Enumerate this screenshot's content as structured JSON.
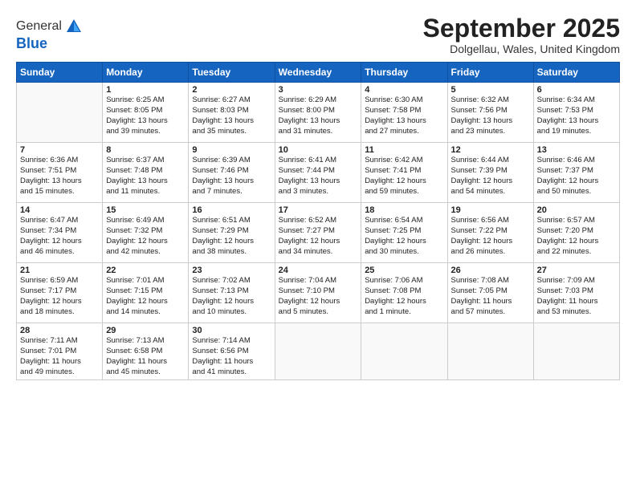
{
  "logo": {
    "general": "General",
    "blue": "Blue"
  },
  "header": {
    "month": "September 2025",
    "location": "Dolgellau, Wales, United Kingdom"
  },
  "weekdays": [
    "Sunday",
    "Monday",
    "Tuesday",
    "Wednesday",
    "Thursday",
    "Friday",
    "Saturday"
  ],
  "weeks": [
    [
      {
        "day": "",
        "info": ""
      },
      {
        "day": "1",
        "info": "Sunrise: 6:25 AM\nSunset: 8:05 PM\nDaylight: 13 hours\nand 39 minutes."
      },
      {
        "day": "2",
        "info": "Sunrise: 6:27 AM\nSunset: 8:03 PM\nDaylight: 13 hours\nand 35 minutes."
      },
      {
        "day": "3",
        "info": "Sunrise: 6:29 AM\nSunset: 8:00 PM\nDaylight: 13 hours\nand 31 minutes."
      },
      {
        "day": "4",
        "info": "Sunrise: 6:30 AM\nSunset: 7:58 PM\nDaylight: 13 hours\nand 27 minutes."
      },
      {
        "day": "5",
        "info": "Sunrise: 6:32 AM\nSunset: 7:56 PM\nDaylight: 13 hours\nand 23 minutes."
      },
      {
        "day": "6",
        "info": "Sunrise: 6:34 AM\nSunset: 7:53 PM\nDaylight: 13 hours\nand 19 minutes."
      }
    ],
    [
      {
        "day": "7",
        "info": "Sunrise: 6:36 AM\nSunset: 7:51 PM\nDaylight: 13 hours\nand 15 minutes."
      },
      {
        "day": "8",
        "info": "Sunrise: 6:37 AM\nSunset: 7:48 PM\nDaylight: 13 hours\nand 11 minutes."
      },
      {
        "day": "9",
        "info": "Sunrise: 6:39 AM\nSunset: 7:46 PM\nDaylight: 13 hours\nand 7 minutes."
      },
      {
        "day": "10",
        "info": "Sunrise: 6:41 AM\nSunset: 7:44 PM\nDaylight: 13 hours\nand 3 minutes."
      },
      {
        "day": "11",
        "info": "Sunrise: 6:42 AM\nSunset: 7:41 PM\nDaylight: 12 hours\nand 59 minutes."
      },
      {
        "day": "12",
        "info": "Sunrise: 6:44 AM\nSunset: 7:39 PM\nDaylight: 12 hours\nand 54 minutes."
      },
      {
        "day": "13",
        "info": "Sunrise: 6:46 AM\nSunset: 7:37 PM\nDaylight: 12 hours\nand 50 minutes."
      }
    ],
    [
      {
        "day": "14",
        "info": "Sunrise: 6:47 AM\nSunset: 7:34 PM\nDaylight: 12 hours\nand 46 minutes."
      },
      {
        "day": "15",
        "info": "Sunrise: 6:49 AM\nSunset: 7:32 PM\nDaylight: 12 hours\nand 42 minutes."
      },
      {
        "day": "16",
        "info": "Sunrise: 6:51 AM\nSunset: 7:29 PM\nDaylight: 12 hours\nand 38 minutes."
      },
      {
        "day": "17",
        "info": "Sunrise: 6:52 AM\nSunset: 7:27 PM\nDaylight: 12 hours\nand 34 minutes."
      },
      {
        "day": "18",
        "info": "Sunrise: 6:54 AM\nSunset: 7:25 PM\nDaylight: 12 hours\nand 30 minutes."
      },
      {
        "day": "19",
        "info": "Sunrise: 6:56 AM\nSunset: 7:22 PM\nDaylight: 12 hours\nand 26 minutes."
      },
      {
        "day": "20",
        "info": "Sunrise: 6:57 AM\nSunset: 7:20 PM\nDaylight: 12 hours\nand 22 minutes."
      }
    ],
    [
      {
        "day": "21",
        "info": "Sunrise: 6:59 AM\nSunset: 7:17 PM\nDaylight: 12 hours\nand 18 minutes."
      },
      {
        "day": "22",
        "info": "Sunrise: 7:01 AM\nSunset: 7:15 PM\nDaylight: 12 hours\nand 14 minutes."
      },
      {
        "day": "23",
        "info": "Sunrise: 7:02 AM\nSunset: 7:13 PM\nDaylight: 12 hours\nand 10 minutes."
      },
      {
        "day": "24",
        "info": "Sunrise: 7:04 AM\nSunset: 7:10 PM\nDaylight: 12 hours\nand 5 minutes."
      },
      {
        "day": "25",
        "info": "Sunrise: 7:06 AM\nSunset: 7:08 PM\nDaylight: 12 hours\nand 1 minute."
      },
      {
        "day": "26",
        "info": "Sunrise: 7:08 AM\nSunset: 7:05 PM\nDaylight: 11 hours\nand 57 minutes."
      },
      {
        "day": "27",
        "info": "Sunrise: 7:09 AM\nSunset: 7:03 PM\nDaylight: 11 hours\nand 53 minutes."
      }
    ],
    [
      {
        "day": "28",
        "info": "Sunrise: 7:11 AM\nSunset: 7:01 PM\nDaylight: 11 hours\nand 49 minutes."
      },
      {
        "day": "29",
        "info": "Sunrise: 7:13 AM\nSunset: 6:58 PM\nDaylight: 11 hours\nand 45 minutes."
      },
      {
        "day": "30",
        "info": "Sunrise: 7:14 AM\nSunset: 6:56 PM\nDaylight: 11 hours\nand 41 minutes."
      },
      {
        "day": "",
        "info": ""
      },
      {
        "day": "",
        "info": ""
      },
      {
        "day": "",
        "info": ""
      },
      {
        "day": "",
        "info": ""
      }
    ]
  ]
}
